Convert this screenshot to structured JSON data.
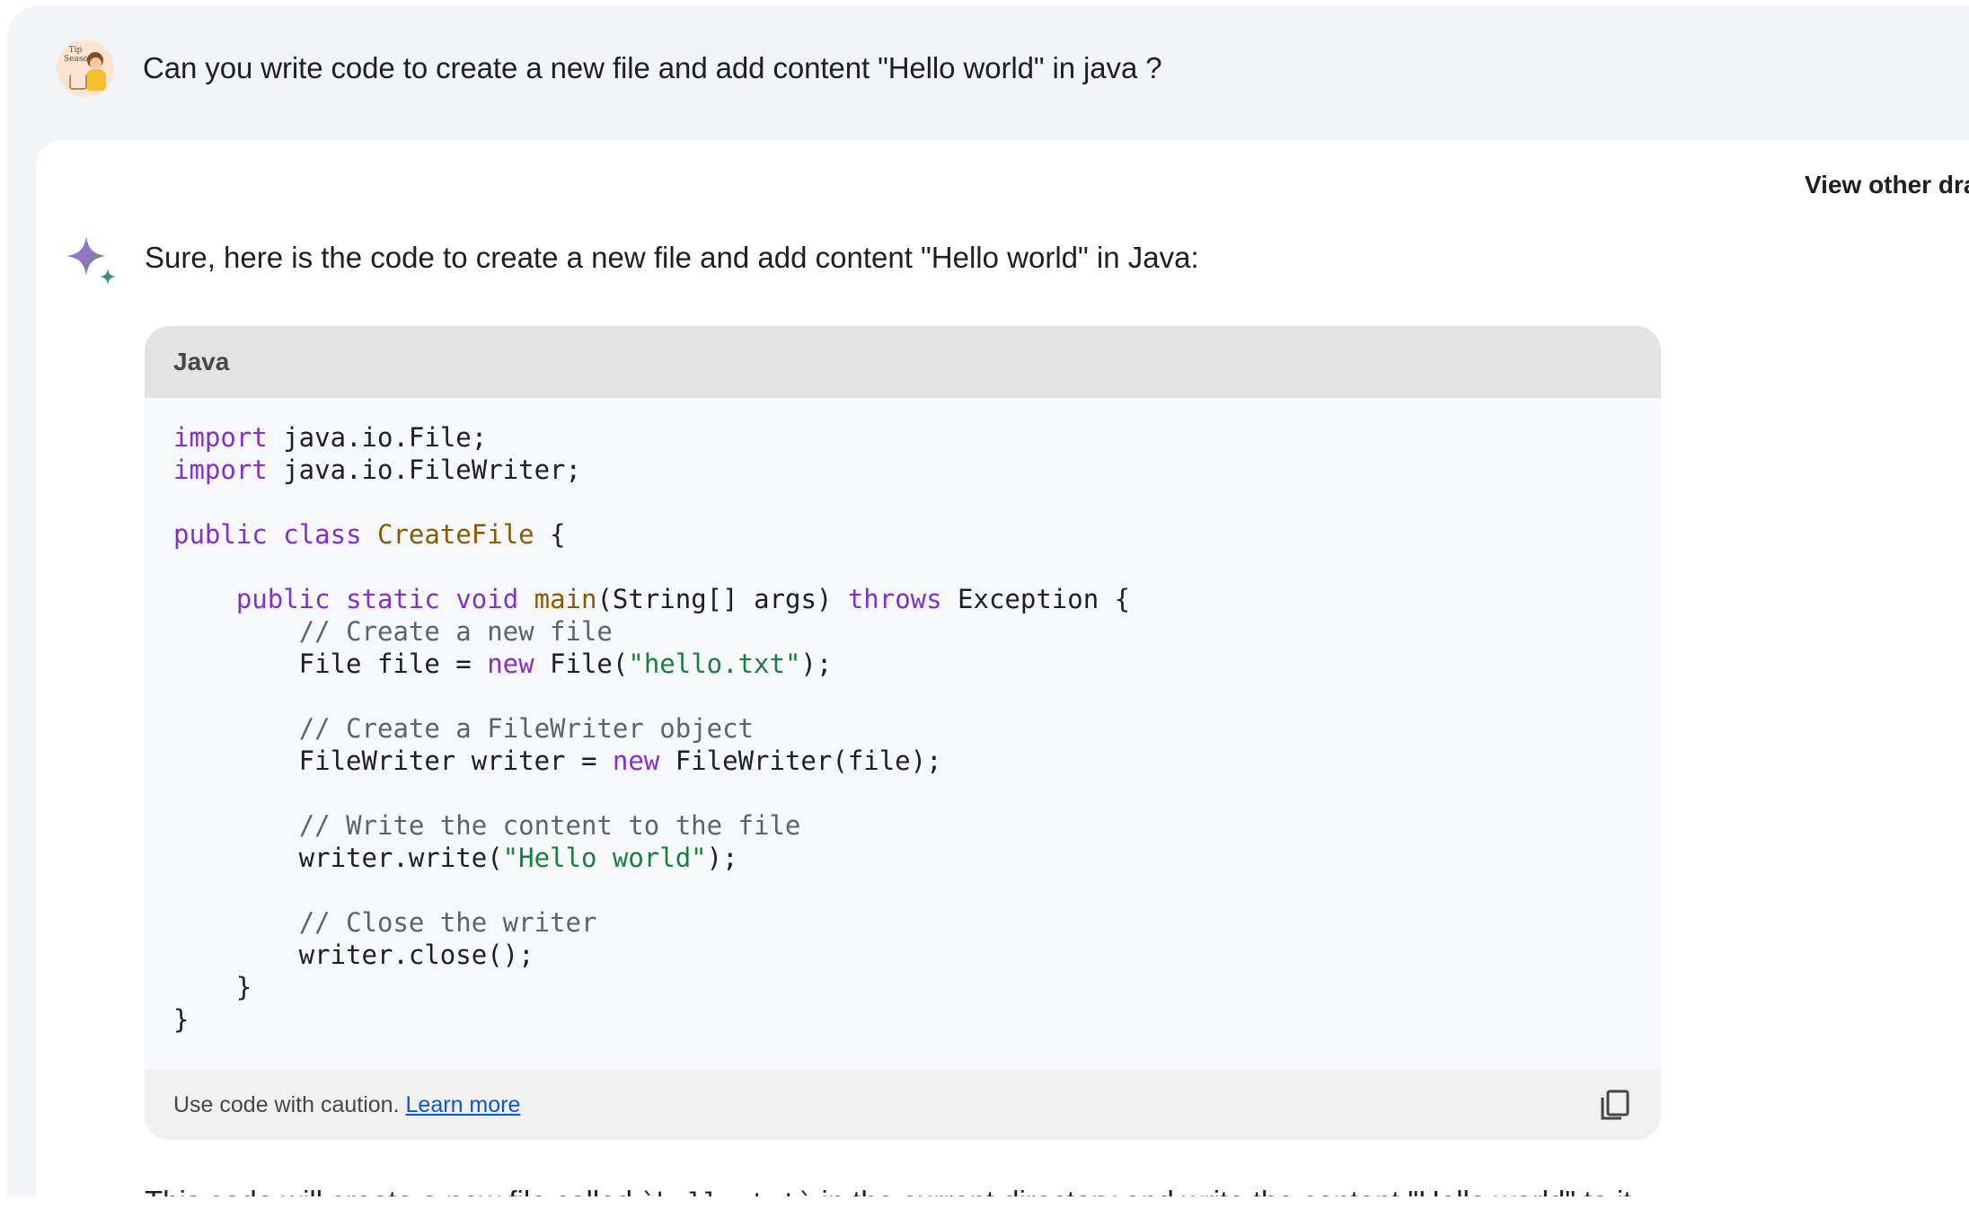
{
  "user_message": {
    "avatar_text": "Tip Season",
    "text": "Can you write code to create a new file and add content \"Hello world\" in java ?"
  },
  "response": {
    "view_drafts_label": "View other drafts",
    "intro": "Sure, here is the code to create a new file and add content \"Hello world\" in Java:",
    "code": {
      "language": "Java",
      "lines": [
        "import java.io.File;",
        "import java.io.FileWriter;",
        "",
        "public class CreateFile {",
        "",
        "    public static void main(String[] args) throws Exception {",
        "        // Create a new file",
        "        File file = new File(\"hello.txt\");",
        "",
        "        // Create a FileWriter object",
        "        FileWriter writer = new FileWriter(file);",
        "",
        "        // Write the content to the file",
        "        writer.write(\"Hello world\");",
        "",
        "        // Close the writer",
        "        writer.close();",
        "    }",
        "}"
      ],
      "caution_text": "Use code with caution.",
      "learn_more_label": "Learn more",
      "copy_icon": "copy-icon"
    },
    "after_text_part1": "This code will create a new file called ",
    "after_text_code": "`hello.txt`",
    "after_text_part2": " in the current directory and write the content \"Hello world\" to it."
  },
  "colors": {
    "keyword": "#8430ce",
    "type": "#8a5a00",
    "string": "#188038",
    "comment": "#5f6368",
    "link": "#0b57d0"
  }
}
